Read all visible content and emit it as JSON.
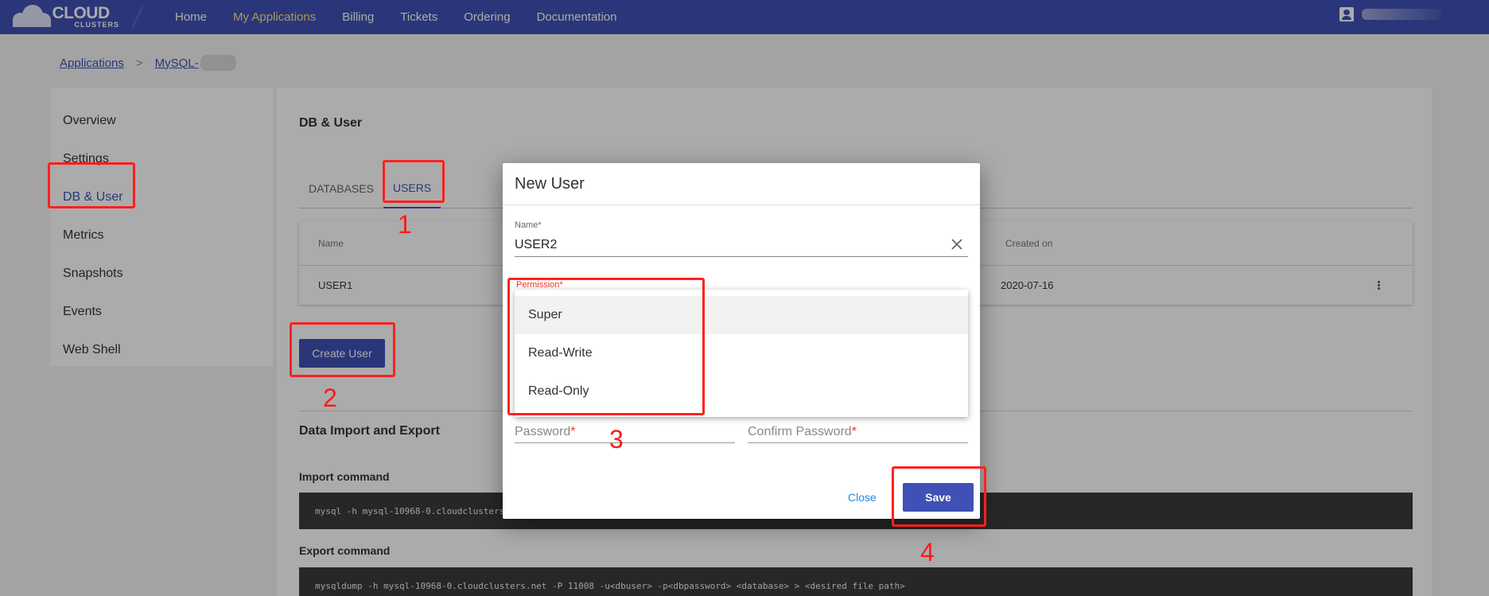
{
  "header": {
    "logo_top": "CLOUD",
    "logo_bottom": "CLUSTERS",
    "nav": [
      {
        "label": "Home"
      },
      {
        "label": "My Applications"
      },
      {
        "label": "Billing"
      },
      {
        "label": "Tickets"
      },
      {
        "label": "Ordering"
      },
      {
        "label": "Documentation"
      }
    ]
  },
  "breadcrumb": {
    "root": "Applications",
    "separator": ">",
    "current": "MySQL-"
  },
  "sidebar": {
    "items": [
      {
        "label": "Overview"
      },
      {
        "label": "Settings"
      },
      {
        "label": "DB & User"
      },
      {
        "label": "Metrics"
      },
      {
        "label": "Snapshots"
      },
      {
        "label": "Events"
      },
      {
        "label": "Web Shell"
      }
    ]
  },
  "main": {
    "title": "DB & User",
    "tabs": [
      {
        "label": "DATABASES"
      },
      {
        "label": "USERS"
      }
    ],
    "table": {
      "headers": {
        "name": "Name",
        "created": "Created on"
      },
      "rows": [
        {
          "name": "USER1",
          "created": "2020-07-16"
        }
      ]
    },
    "create_button": "Create User",
    "import_export_title": "Data Import and Export",
    "import_label": "Import command",
    "import_cmd": "mysql -h mysql-10968-0.cloudclusters",
    "export_label": "Export command",
    "export_cmd": "mysqldump -h mysql-10968-0.cloudclusters.net -P 11008 -u<dbuser> -p<dbpassword> <database> > <desired file path>"
  },
  "dialog": {
    "title": "New User",
    "name_label": "Name",
    "name_value": "USER2",
    "permission_label": "Permission",
    "permission_options": [
      {
        "label": "Super"
      },
      {
        "label": "Read-Write"
      },
      {
        "label": "Read-Only"
      }
    ],
    "password_label": "Password",
    "confirm_label": "Confirm Password",
    "required_mark": "*",
    "close_label": "Close",
    "save_label": "Save"
  },
  "annotations": [
    "1",
    "2",
    "3",
    "4"
  ],
  "colors": {
    "primary": "#3f51b5",
    "active_nav": "#ffe082",
    "annotation": "#ff2020",
    "link": "#1e88e5"
  }
}
